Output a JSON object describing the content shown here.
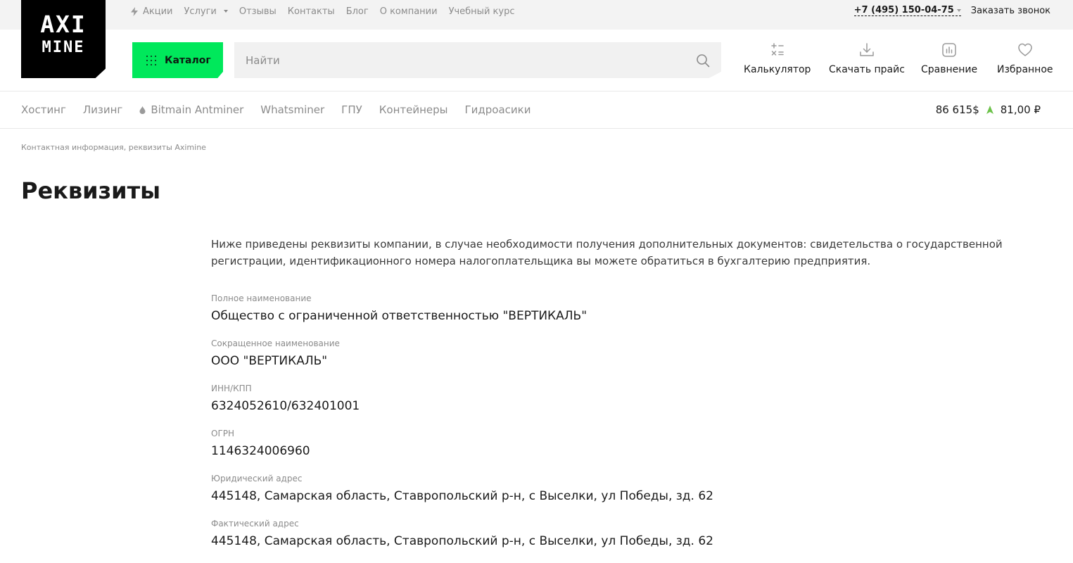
{
  "logo": {
    "line1": "AXI",
    "line2": "MINE"
  },
  "topbar": {
    "links": [
      {
        "label": "Акции",
        "icon": "lightning-icon"
      },
      {
        "label": "Услуги",
        "dropdown": true
      },
      {
        "label": "Отзывы"
      },
      {
        "label": "Контакты"
      },
      {
        "label": "Блог"
      },
      {
        "label": "О компании"
      },
      {
        "label": "Учебный курс"
      }
    ],
    "phone": "+7 (495) 150-04-75",
    "callback": "Заказать звонок"
  },
  "catalog": {
    "label": "Каталог"
  },
  "search": {
    "placeholder": "Найти"
  },
  "tools": [
    {
      "label": "Калькулятор",
      "icon": "calculator-icon"
    },
    {
      "label": "Скачать прайс",
      "icon": "download-icon"
    },
    {
      "label": "Сравнение",
      "icon": "compare-chart-icon"
    },
    {
      "label": "Избранное",
      "icon": "heart-icon"
    }
  ],
  "nav": {
    "items": [
      "Хостинг",
      "Лизинг",
      "Bitmain Antminer",
      "Whatsminer",
      "ГПУ",
      "Контейнеры",
      "Гидроасики"
    ]
  },
  "rate": {
    "btc": "86 615$",
    "rub": "81,00 ₽",
    "trend_color": "#6cc24a"
  },
  "breadcrumb": "Контактная информация, реквизиты Aximine",
  "page": {
    "title": "Реквизиты",
    "intro": "Ниже приведены реквизиты компании, в случае необходимости получения дополнительных документов: свидетельства о государственной регистрации, идентификационного номера налогоплательщика вы можете обратиться в бухгалтерию предприятия.",
    "requisites": [
      {
        "label": "Полное наименование",
        "value": "Общество с ограниченной ответственностью \"ВЕРТИКАЛЬ\""
      },
      {
        "label": "Сокращенное наименование",
        "value": "ООО \"ВЕРТИКАЛЬ\""
      },
      {
        "label": "ИНН/КПП",
        "value": "6324052610/632401001"
      },
      {
        "label": "ОГРН",
        "value": "1146324006960"
      },
      {
        "label": "Юридический адрес",
        "value": "445148, Самарская область, Ставропольский р-н, с Выселки, ул Победы, зд. 62"
      },
      {
        "label": "Фактический адрес",
        "value": "445148, Самарская область, Ставропольский р-н, с Выселки, ул Победы, зд. 62"
      }
    ]
  },
  "colors": {
    "accent": "#00e85b",
    "logo_bg": "#000000",
    "muted": "#8b8b8b"
  }
}
